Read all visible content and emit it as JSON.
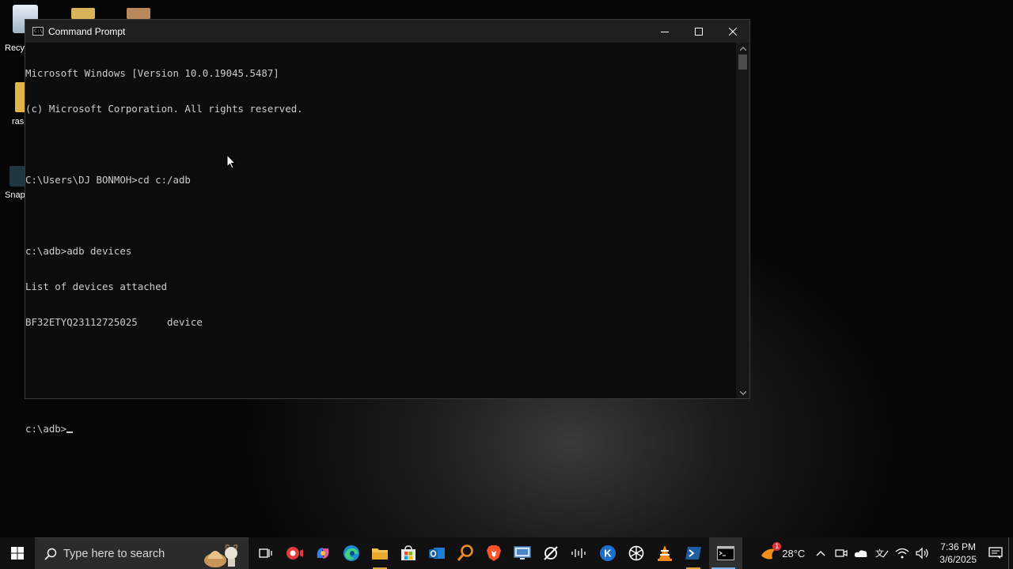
{
  "desktop": {
    "icons": [
      {
        "label": "Recy"
      },
      {
        "label": "ras"
      },
      {
        "label": "Snap"
      }
    ]
  },
  "window": {
    "title": "Command Prompt",
    "console_lines": [
      "Microsoft Windows [Version 10.0.19045.5487]",
      "(c) Microsoft Corporation. All rights reserved.",
      "",
      "C:\\Users\\DJ BONMOH>cd c:/adb",
      "",
      "c:\\adb>adb devices",
      "List of devices attached",
      "BF32ETYQ23112725025     device",
      "",
      ""
    ],
    "prompt": "c:\\adb>"
  },
  "taskbar": {
    "search_placeholder": "Type here to search",
    "apps": [
      {
        "name": "task-view-icon"
      },
      {
        "name": "screen-recorder-icon"
      },
      {
        "name": "copilot-icon"
      },
      {
        "name": "edge-icon"
      },
      {
        "name": "file-explorer-icon"
      },
      {
        "name": "microsoft-store-icon"
      },
      {
        "name": "outlook-icon"
      },
      {
        "name": "search-magnifier-app-icon"
      },
      {
        "name": "brave-icon"
      },
      {
        "name": "remote-desktop-icon"
      },
      {
        "name": "sync-app-icon"
      },
      {
        "name": "audio-app-icon"
      },
      {
        "name": "k-app-icon"
      },
      {
        "name": "chatgpt-icon"
      },
      {
        "name": "vlc-icon"
      },
      {
        "name": "powershell-icon"
      },
      {
        "name": "command-prompt-icon"
      }
    ],
    "weather": {
      "temp": "28°C",
      "badge": "1"
    },
    "clock": {
      "time": "7:36 PM",
      "date": "3/6/2025"
    }
  },
  "colors": {
    "console_bg": "#0c0c0c",
    "console_text": "#cccccc",
    "titlebar_bg": "#1f1f1f",
    "taskbar_bg": "#101010",
    "accent_active": "#7ab1e6"
  }
}
